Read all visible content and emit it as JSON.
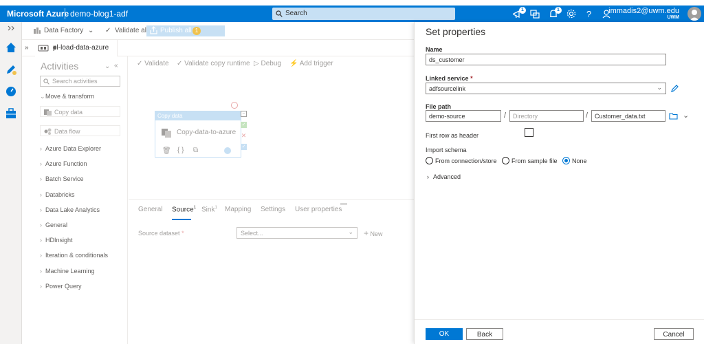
{
  "topbar": {
    "brand": "Microsoft Azure",
    "factory_name": "demo-blog1-adf",
    "search_placeholder": "Search",
    "notification_badge_1": "1",
    "notification_badge_2": "1",
    "user_email": "immadis2@uwm.edu",
    "user_org": "UWM"
  },
  "toolbar": {
    "data_factory": "Data Factory",
    "validate_all": "Validate all",
    "publish_all": "Publish all",
    "publish_count": "1"
  },
  "pipeline_tab": {
    "name": "pl-load-data-azure"
  },
  "activities": {
    "title": "Activities",
    "search_placeholder": "Search activities",
    "move_transform": "Move & transform",
    "copy_data": "Copy data",
    "data_flow": "Data flow",
    "categories": [
      "Azure Data Explorer",
      "Azure Function",
      "Batch Service",
      "Databricks",
      "Data Lake Analytics",
      "General",
      "HDInsight",
      "Iteration & conditionals",
      "Machine Learning",
      "Power Query"
    ]
  },
  "canvas_toolbar": {
    "validate": "Validate",
    "validate_runtime": "Validate copy runtime",
    "debug": "Debug",
    "add_trigger": "Add trigger"
  },
  "node": {
    "header": "Copy data",
    "name": "Copy-data-to-azure"
  },
  "properties": {
    "tabs": [
      "General",
      "Source",
      "Sink",
      "Mapping",
      "Settings",
      "User properties"
    ],
    "source_badge": "1",
    "sink_badge": "1",
    "source_dataset_label": "Source dataset",
    "req": "*",
    "select_placeholder": "Select...",
    "new_label": "New"
  },
  "panel": {
    "title": "Set properties",
    "name_label": "Name",
    "name_value": "ds_customer",
    "linked_service_label": "Linked service",
    "linked_service_value": "adfsourcelink",
    "file_path_label": "File path",
    "file_path_container": "demo-source",
    "file_path_directory_placeholder": "Directory",
    "file_path_file": "Customer_data.txt",
    "slash": "/",
    "first_row_label": "First row as header",
    "import_schema_label": "Import schema",
    "radio_options": [
      "From connection/store",
      "From sample file",
      "None"
    ],
    "advanced_label": "Advanced",
    "ok": "OK",
    "back": "Back",
    "cancel": "Cancel"
  }
}
